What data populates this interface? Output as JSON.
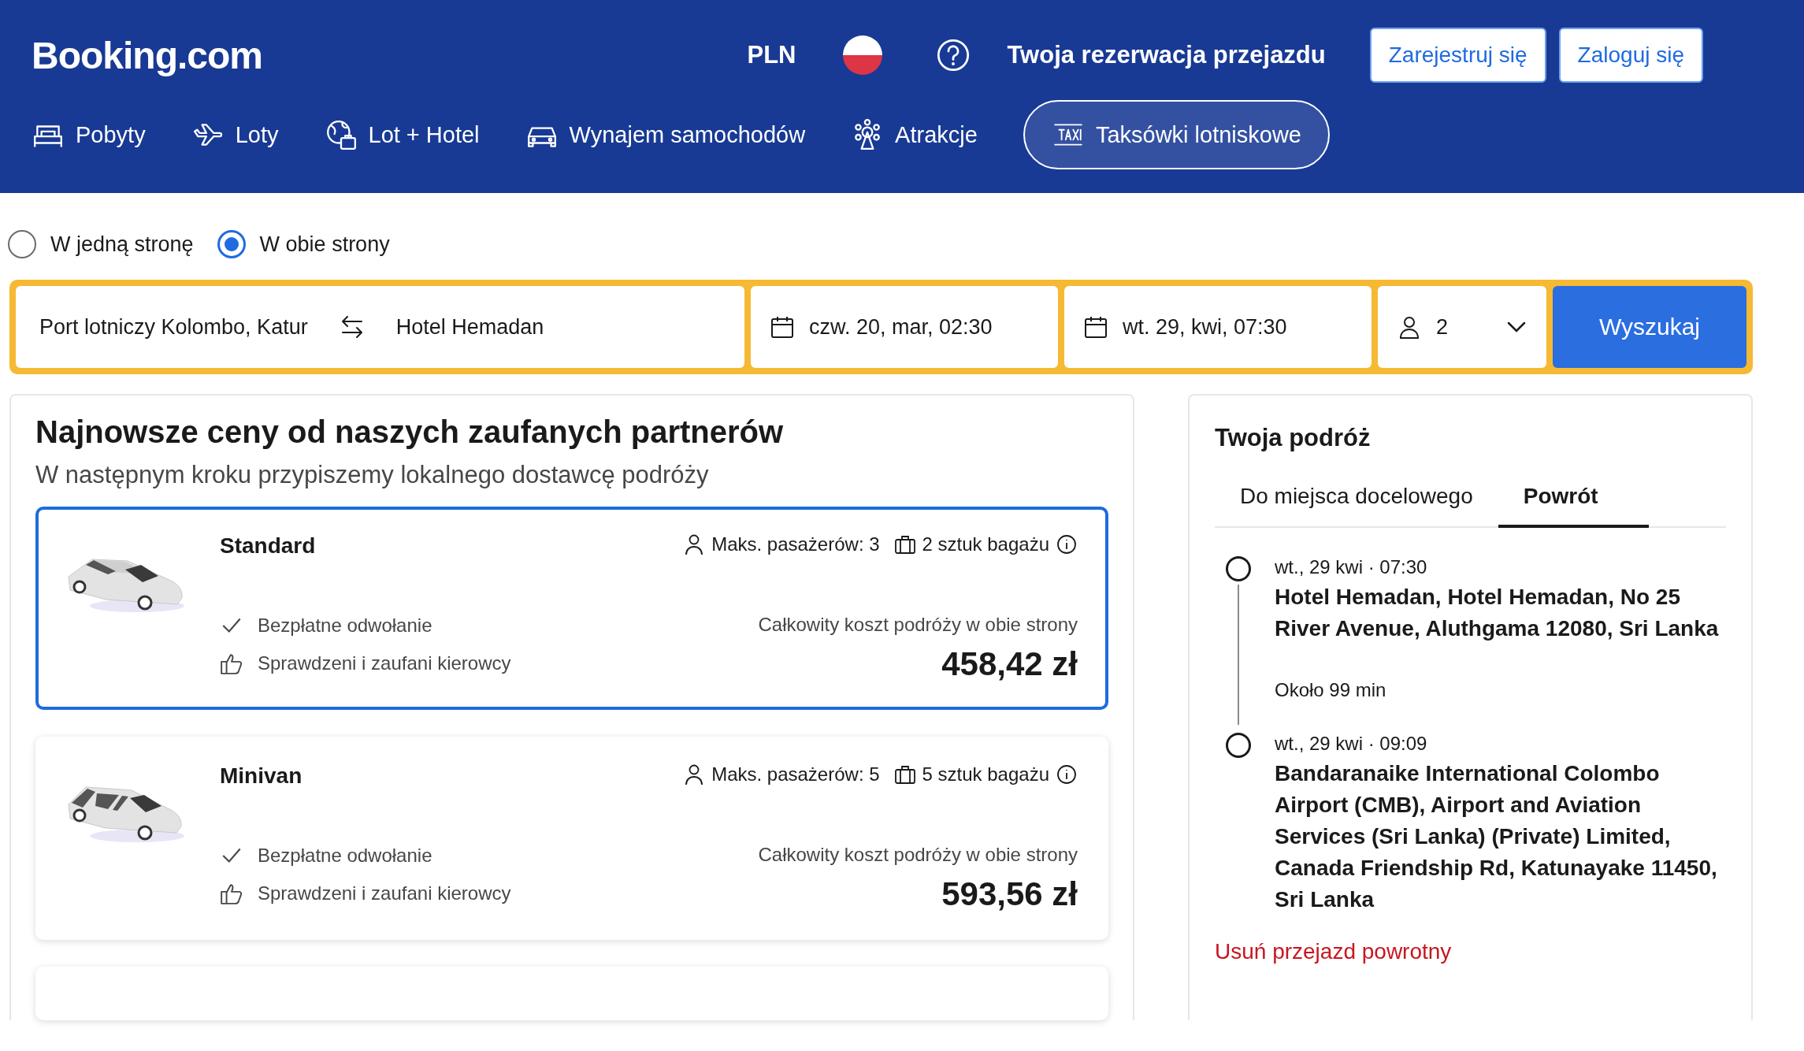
{
  "header": {
    "logo": "Booking.com",
    "currency": "PLN",
    "trip_link": "Twoja rezerwacja przejazdu",
    "buttons": [
      "Zarejestruj się",
      "Zaloguj się"
    ]
  },
  "nav": [
    {
      "label": "Pobyty",
      "selected": false
    },
    {
      "label": "Loty",
      "selected": false
    },
    {
      "label": "Lot + Hotel",
      "selected": false
    },
    {
      "label": "Wynajem samochodów",
      "selected": false
    },
    {
      "label": "Atrakcje",
      "selected": false
    },
    {
      "label": "Taksówki lotniskowe",
      "selected": true
    }
  ],
  "trip_type": [
    {
      "label": "W jedną stronę",
      "selected": false
    },
    {
      "label": "W obie strony",
      "selected": true
    }
  ],
  "search": {
    "from": "Port lotniczy Kolombo, Katur",
    "to": "Hotel Hemadan",
    "depart": "czw. 20, mar, 02:30",
    "return": "wt. 29, kwi, 07:30",
    "passengers": "2",
    "button": "Wyszukaj"
  },
  "offers": {
    "title": "Najnowsze ceny od naszych zaufanych partnerów",
    "subtitle": "W następnym kroku przypiszemy lokalnego dostawcę podróży",
    "cards": [
      {
        "kind": "sedan",
        "name": "Standard",
        "passengers": "Maks. pasażerów: 3",
        "luggage": "2 sztuk bagażu",
        "features": [
          "Bezpłatne odwołanie",
          "Sprawdzeni i zaufani kierowcy"
        ],
        "price_label": "Całkowity koszt podróży w obie strony",
        "price": "458,42 zł",
        "selected": true
      },
      {
        "kind": "minivan",
        "name": "Minivan",
        "passengers": "Maks. pasażerów: 5",
        "luggage": "5 sztuk bagażu",
        "features": [
          "Bezpłatne odwołanie",
          "Sprawdzeni i zaufani kierowcy"
        ],
        "price_label": "Całkowity koszt podróży w obie strony",
        "price": "593,56 zł",
        "selected": false
      }
    ]
  },
  "trip": {
    "title": "Twoja podróż",
    "tabs": [
      {
        "label": "Do miejsca docelowego",
        "selected": false
      },
      {
        "label": "Powrót",
        "selected": true
      }
    ],
    "stops": [
      {
        "time": "wt., 29 kwi · 07:30",
        "address": "Hotel Hemadan, Hotel Hemadan, No 25 River Avenue, Aluthgama 12080, Sri Lanka"
      },
      {
        "time": "wt., 29 kwi · 09:09",
        "address": "Bandaranaike International Colombo Airport (CMB), Airport and Aviation Services (Sri Lanka) (Private) Limited, Canada Friendship Rd, Katunayake 11450, Sri Lanka"
      }
    ],
    "duration": "Około 99 min",
    "remove_link": "Usuń przejazd powrotny"
  }
}
